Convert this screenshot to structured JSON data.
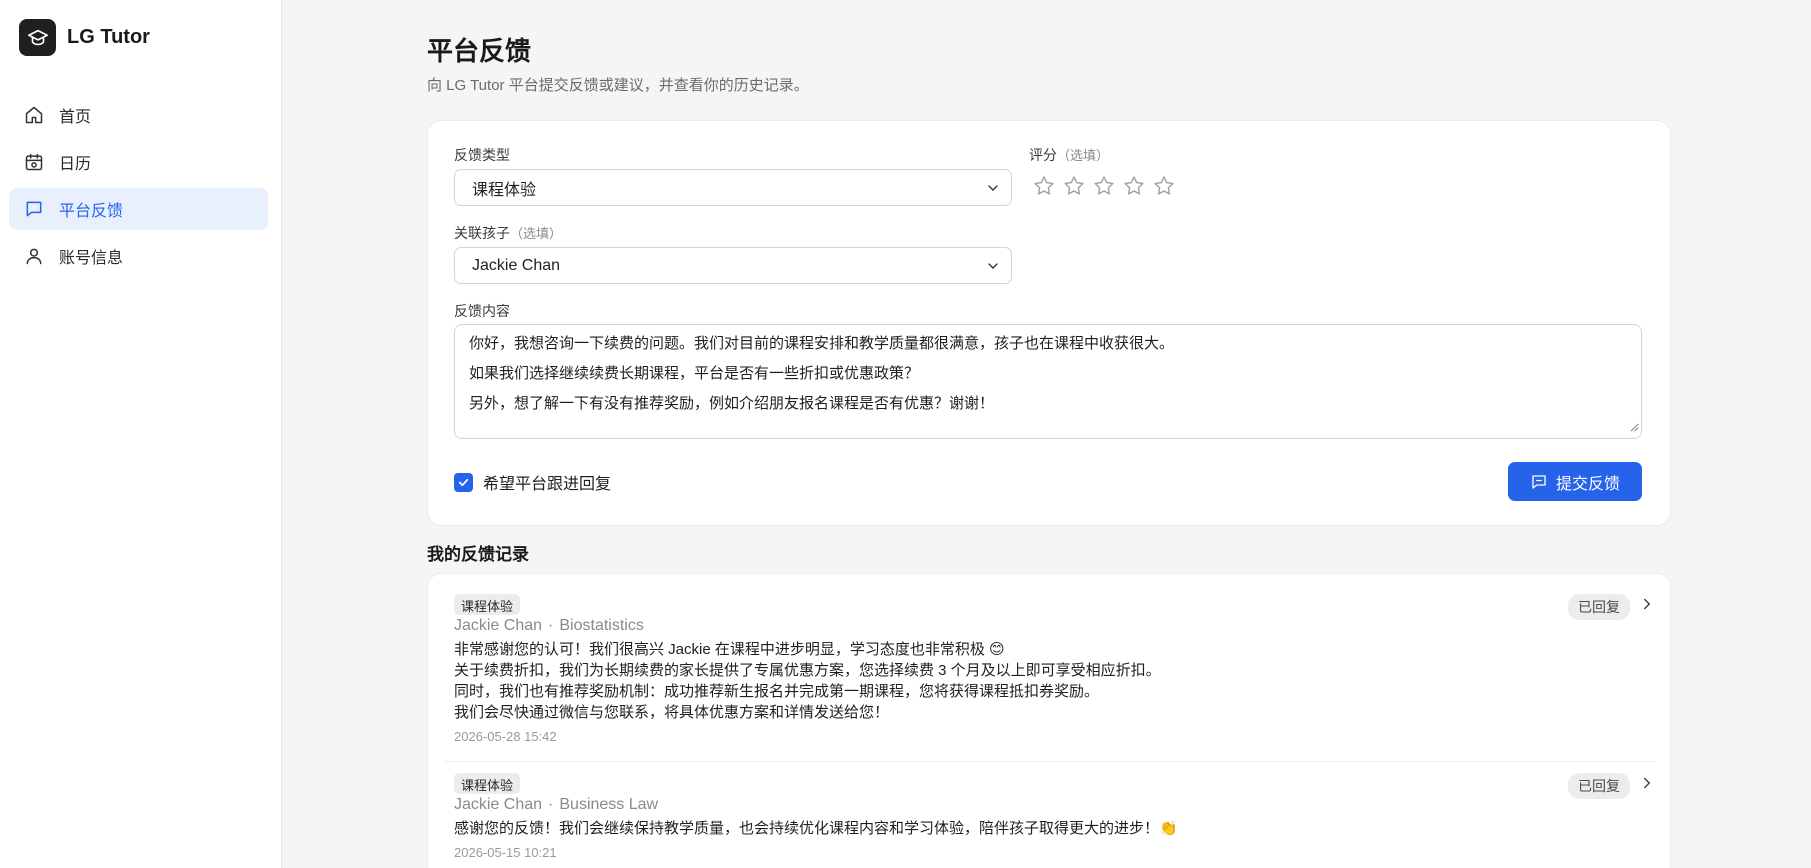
{
  "app": {
    "name": "LG Tutor"
  },
  "sidebar": {
    "items": [
      {
        "label": "首页",
        "icon": "home-icon"
      },
      {
        "label": "日历",
        "icon": "calendar-icon"
      },
      {
        "label": "平台反馈",
        "icon": "message-icon",
        "active": true
      },
      {
        "label": "账号信息",
        "icon": "user-icon"
      }
    ]
  },
  "page": {
    "title": "平台反馈",
    "subtitle": "向 LG Tutor 平台提交反馈或建议，并查看你的历史记录。"
  },
  "form": {
    "type_label": "反馈类型",
    "type_value": "课程体验",
    "rating_label": "评分",
    "rating_optional": "（选填）",
    "rating_value": 0,
    "rating_max": 5,
    "child_label": "关联孩子",
    "child_optional": "（选填）",
    "child_value": "Jackie Chan",
    "content_label": "反馈内容",
    "content_lines": [
      "你好，我想咨询一下续费的问题。我们对目前的课程安排和教学质量都很满意，孩子也在课程中收获很大。",
      "如果我们选择继续续费长期课程，平台是否有一些折扣或优惠政策？",
      "另外，想了解一下有没有推荐奖励，例如介绍朋友报名课程是否有优惠？谢谢！"
    ],
    "follow_up_label": "希望平台跟进回复",
    "follow_up_checked": true,
    "submit_label": "提交反馈"
  },
  "records": {
    "title": "我的反馈记录",
    "items": [
      {
        "tag": "课程体验",
        "child": "Jackie Chan",
        "separator": "·",
        "course": "Biostatistics",
        "status": "已回复",
        "lines": [
          "非常感谢您的认可！我们很高兴 Jackie 在课程中进步明显，学习态度也非常积极 😊",
          "关于续费折扣，我们为长期续费的家长提供了专属优惠方案，您选择续费 3 个月及以上即可享受相应折扣。",
          "同时，我们也有推荐奖励机制：成功推荐新生报名并完成第一期课程，您将获得课程抵扣券奖励。",
          "我们会尽快通过微信与您联系，将具体优惠方案和详情发送给您！"
        ],
        "time": "2026-05-28 15:42"
      },
      {
        "tag": "课程体验",
        "child": "Jackie Chan",
        "separator": "·",
        "course": "Business Law",
        "status": "已回复",
        "lines": [
          "感谢您的反馈！我们会继续保持教学质量，也会持续优化课程内容和学习体验，陪伴孩子取得更大的进步！👏"
        ],
        "time": "2026-05-15 10:21"
      }
    ]
  },
  "colors": {
    "accent": "#2563eb",
    "active_bg": "#e8f0fe"
  }
}
